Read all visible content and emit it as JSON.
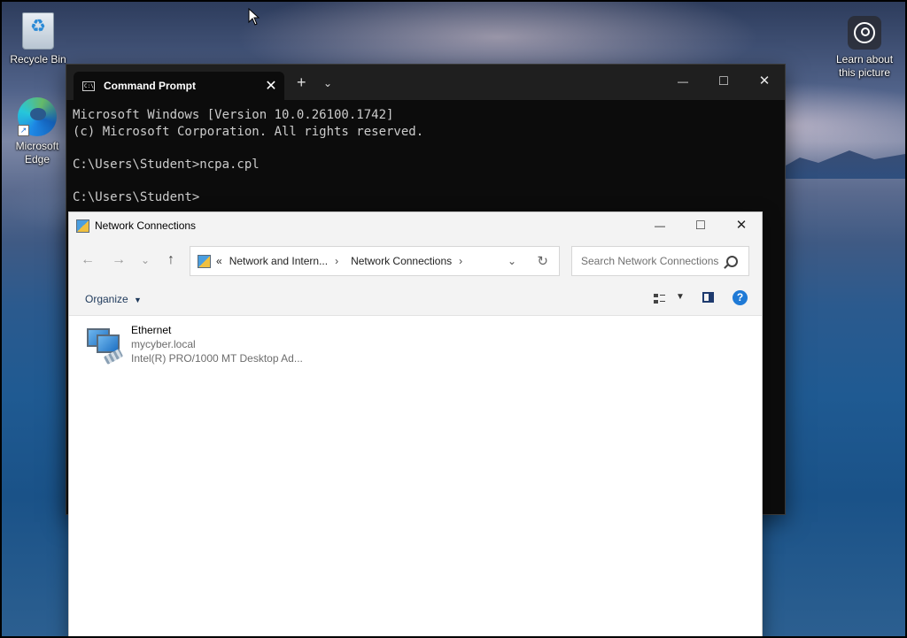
{
  "desktop": {
    "icons": [
      {
        "label": "Recycle Bin"
      },
      {
        "label": "Microsoft Edge"
      },
      {
        "label": "Learn about this picture"
      }
    ]
  },
  "cmd": {
    "tab_title": "Command Prompt",
    "lines": [
      "Microsoft Windows [Version 10.0.26100.1742]",
      "(c) Microsoft Corporation. All rights reserved.",
      "",
      "C:\\Users\\Student>ncpa.cpl",
      "",
      "C:\\Users\\Student>"
    ]
  },
  "ncpa": {
    "title": "Network Connections",
    "breadcrumb": {
      "overflow": "«",
      "parent": "Network and Intern...",
      "current": "Network Connections"
    },
    "search_placeholder": "Search Network Connections",
    "toolbar": {
      "organize_label": "Organize"
    },
    "connections": [
      {
        "name": "Ethernet",
        "network": "mycyber.local",
        "adapter": "Intel(R) PRO/1000 MT Desktop Ad..."
      }
    ]
  },
  "icons": {
    "close": "✕",
    "minimize": "—",
    "maximize": "□",
    "back": "←",
    "forward": "→",
    "chevron_down": "⌄",
    "up": "↑",
    "chevron_right": "›",
    "refresh": "↻",
    "plus": "+",
    "help": "?"
  }
}
